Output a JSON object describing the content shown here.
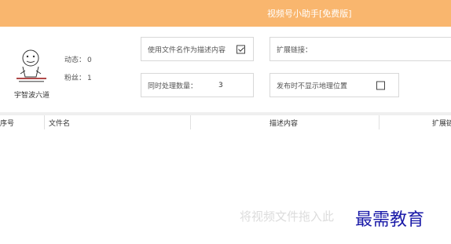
{
  "window": {
    "title": "视频号小助手[免费版]"
  },
  "profile": {
    "avatar_caption": "宇智波六道",
    "dynamics_label": "动态：",
    "dynamics_value": "0",
    "fans_label": "粉丝：",
    "fans_value": "1"
  },
  "options": {
    "use_filename_label": "使用文件名作为描述内容",
    "use_filename_checked": true,
    "extend_link_label": "扩展链接：",
    "extend_link_value": "",
    "concurrency_label": "同时处理数量：",
    "concurrency_value": "3",
    "hide_location_label": "发布时不显示地理位置",
    "hide_location_checked": false
  },
  "table": {
    "columns": [
      "序号",
      "文件名",
      "描述内容",
      "扩展链"
    ]
  },
  "drop_hint": "将视频文件拖入此",
  "watermark": "最需教育",
  "colors": {
    "accent": "#f9b66e",
    "watermark": "#1a1aa8"
  }
}
